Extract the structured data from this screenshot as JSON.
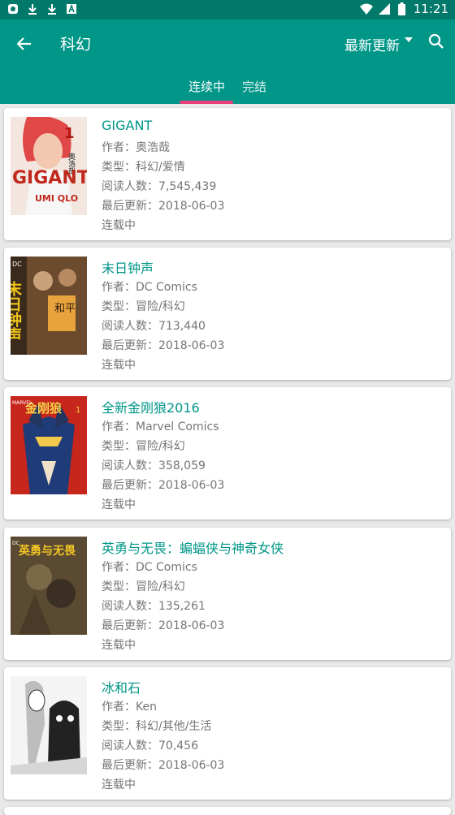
{
  "status_bar": {
    "time": "11:21"
  },
  "toolbar": {
    "title": "科幻",
    "sort_label": "最新更新"
  },
  "tabs": [
    {
      "label": "连续中"
    },
    {
      "label": "完结"
    }
  ],
  "comics": [
    {
      "title": "GIGANT",
      "author": "作者：奥浩哉",
      "genre": "类型：科幻/爱情",
      "readers": "阅读人数：7,545,439",
      "updated": "最后更新：2018-06-03",
      "status": "连载中"
    },
    {
      "title": "末日钟声",
      "author": "作者：DC Comics",
      "genre": "类型：冒险/科幻",
      "readers": "阅读人数：713,440",
      "updated": "最后更新：2018-06-03",
      "status": "连载中"
    },
    {
      "title": "全新金刚狼2016",
      "author": "作者：Marvel Comics",
      "genre": "类型：冒险/科幻",
      "readers": "阅读人数：358,059",
      "updated": "最后更新：2018-06-03",
      "status": "连载中"
    },
    {
      "title": "英勇与无畏：蝙蝠侠与神奇女侠",
      "author": "作者：DC Comics",
      "genre": "类型：冒险/科幻",
      "readers": "阅读人数：135,261",
      "updated": "最后更新：2018-06-03",
      "status": "连载中"
    },
    {
      "title": "冰和石",
      "author": "作者：Ken",
      "genre": "类型：科幻/其他/生活",
      "readers": "阅读人数：70,456",
      "updated": "最后更新：2018-06-03",
      "status": "连载中"
    }
  ],
  "covers": {
    "c1": {
      "text_top": "奥浩哉",
      "text_mid": "GIGANT",
      "text_bot": "UMI QLO",
      "num": "1"
    },
    "c2": {
      "text": "末日钟声",
      "sign": "和平",
      "badge": "DC"
    },
    "c3": {
      "text": "金刚狼",
      "badge": "MARVEL",
      "num": "1"
    },
    "c4": {
      "text": "英勇与无畏",
      "badge": "DC"
    },
    "c5": {}
  },
  "colors": {
    "primary": "#009688",
    "status_bar": "#00796b",
    "accent": "#ec407a",
    "title_text": "#009688"
  }
}
